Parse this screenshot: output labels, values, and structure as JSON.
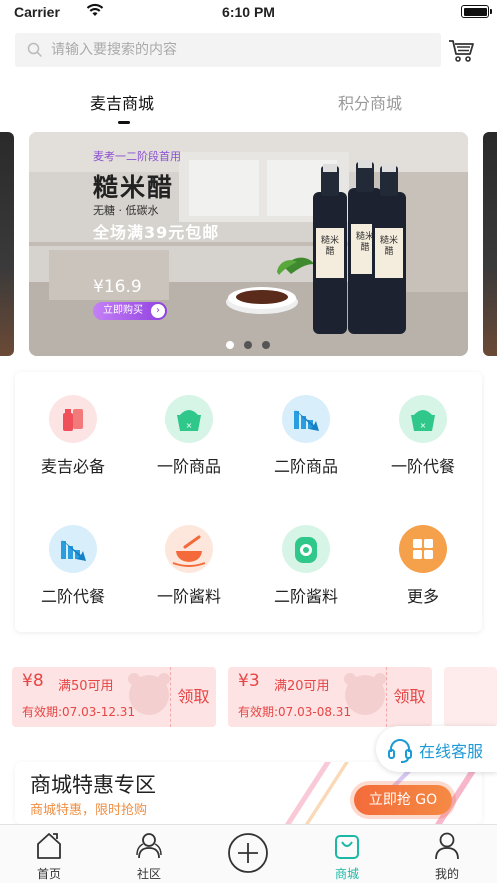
{
  "status_bar": {
    "carrier": "Carrier",
    "time": "6:10 PM"
  },
  "search": {
    "placeholder": "请输入要搜索的内容"
  },
  "tabs": [
    {
      "label": "麦吉商城",
      "active": true
    },
    {
      "label": "积分商城",
      "active": false
    }
  ],
  "banner": {
    "tag": "麦考一二阶段首用",
    "title": "糙米醋",
    "subtitle": "无糖 · 低碳水",
    "promo": "全场满39元包邮",
    "price": "¥16.9",
    "button": "立即购买",
    "bottle_label": "糙米醋",
    "dots": 3,
    "active_dot": 0
  },
  "categories": [
    {
      "label": "麦吉必备",
      "icon": "essentials-icon"
    },
    {
      "label": "一阶商品",
      "icon": "pot-icon"
    },
    {
      "label": "二阶商品",
      "icon": "trend-down-icon"
    },
    {
      "label": "一阶代餐",
      "icon": "pot-icon"
    },
    {
      "label": "二阶代餐",
      "icon": "trend-down-icon"
    },
    {
      "label": "一阶酱料",
      "icon": "sauce-bowl-icon"
    },
    {
      "label": "二阶酱料",
      "icon": "sauce-bottle-icon"
    },
    {
      "label": "更多",
      "icon": "grid-more-icon"
    }
  ],
  "coupons": [
    {
      "amount": "¥8",
      "condition": "满50可用",
      "validity": "有效期:07.03-12.31",
      "claim": "领取"
    },
    {
      "amount": "¥3",
      "condition": "满20可用",
      "validity": "有效期:07.03-08.31",
      "claim": "领取"
    }
  ],
  "customer_service": {
    "label": "在线客服"
  },
  "special_zone": {
    "title": "商城特惠专区",
    "subtitle": "商城特惠，限时抢购",
    "button": "立即抢 GO"
  },
  "nav": [
    {
      "label": "首页",
      "icon": "home-icon",
      "active": false
    },
    {
      "label": "社区",
      "icon": "community-icon",
      "active": false
    },
    {
      "label": "",
      "icon": "plus-icon",
      "active": false
    },
    {
      "label": "商城",
      "icon": "shopping-bag-icon",
      "active": true
    },
    {
      "label": "我的",
      "icon": "profile-icon",
      "active": false
    }
  ],
  "colors": {
    "accent_teal": "#1bb8a5",
    "coupon_red": "#e64545",
    "cs_blue": "#1c9ad6",
    "promo_orange": "#f36c3a"
  }
}
